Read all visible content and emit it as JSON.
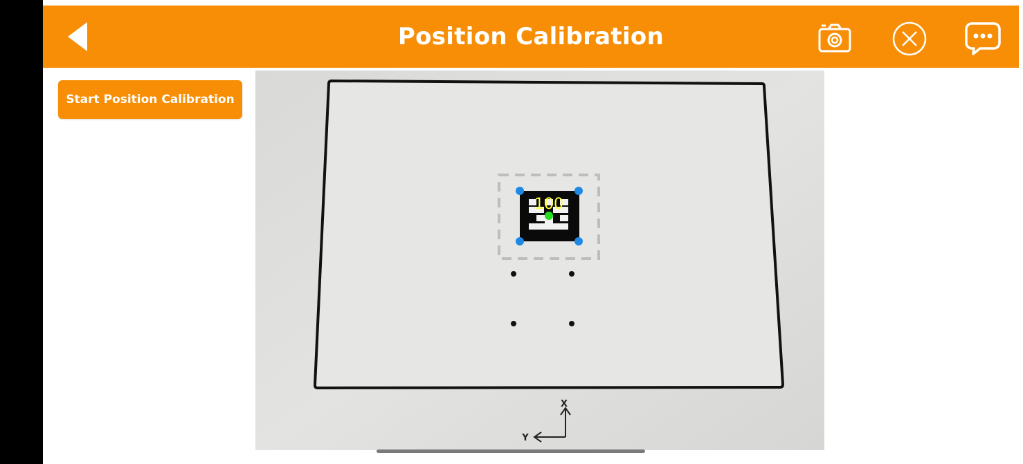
{
  "header": {
    "title": "Position Calibration",
    "back_icon": "back-arrow-icon",
    "camera_icon": "camera-icon",
    "close_icon": "close-circle-icon",
    "chat_icon": "chat-bubble-icon"
  },
  "controls": {
    "start_button_label": "Start Position Calibration"
  },
  "camera_view": {
    "marker_id": "100",
    "axis_x_label": "X",
    "axis_y_label": "Y"
  },
  "colors": {
    "accent": "#f78e06",
    "left_bar": "#000000",
    "corner_points": "#1e88e5",
    "center_point": "#22dd22",
    "marker_id_text": "#ffff33"
  }
}
